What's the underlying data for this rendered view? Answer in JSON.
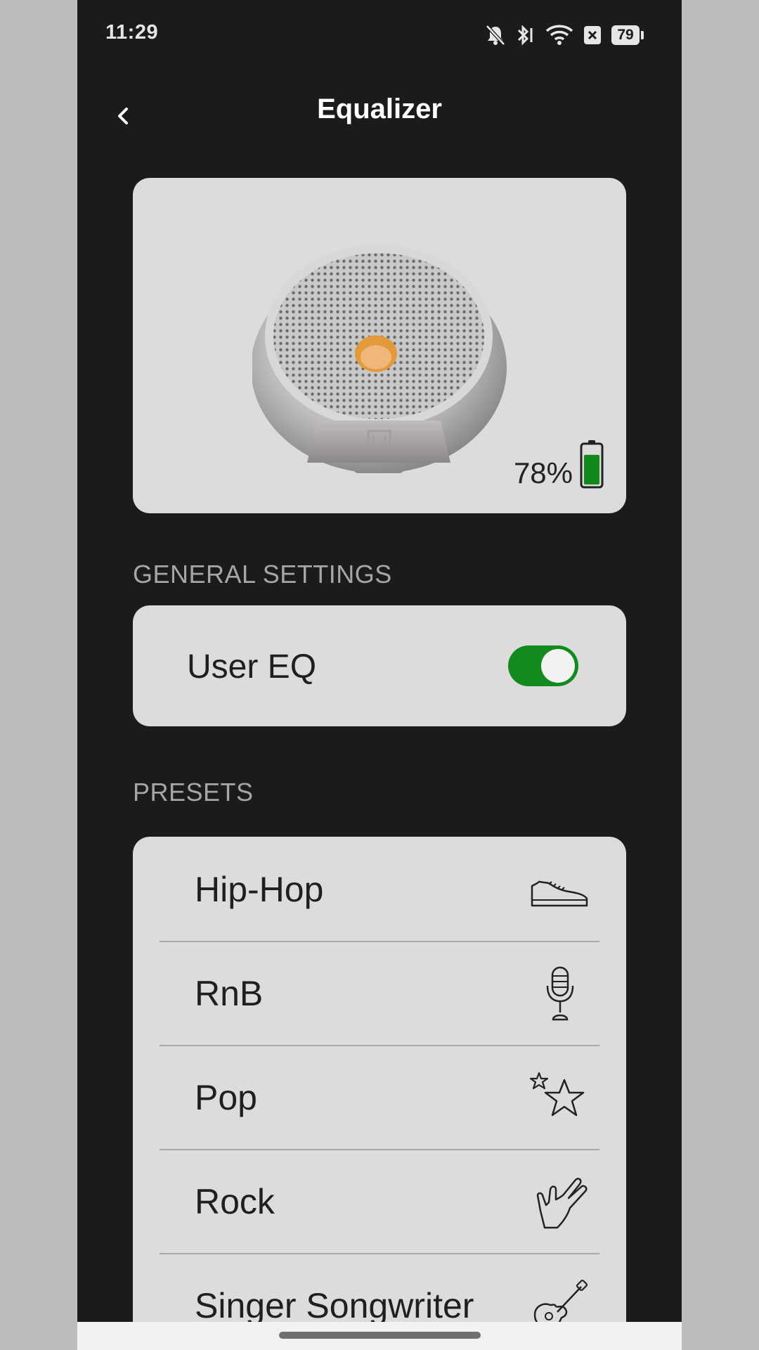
{
  "status_bar": {
    "time": "11:29",
    "battery_level": "79",
    "icons": [
      "bell-off-icon",
      "bluetooth-icon",
      "wifi-icon",
      "x-box-icon",
      "battery-icon"
    ]
  },
  "header": {
    "title": "Equalizer",
    "back_icon": "chevron-left-icon"
  },
  "device": {
    "battery_percent": "78%",
    "battery_fraction": 0.78,
    "battery_color": "#128a1b",
    "image": "speaker-image"
  },
  "general_settings": {
    "section_label": "GENERAL SETTINGS",
    "user_eq": {
      "label": "User EQ",
      "enabled": true
    }
  },
  "presets": {
    "section_label": "PRESETS",
    "items": [
      {
        "label": "Hip-Hop",
        "icon": "sneaker-icon"
      },
      {
        "label": "RnB",
        "icon": "microphone-icon"
      },
      {
        "label": "Pop",
        "icon": "stars-icon"
      },
      {
        "label": "Rock",
        "icon": "rock-hand-icon"
      },
      {
        "label": "Singer Songwriter",
        "icon": "guitar-icon"
      }
    ]
  },
  "colors": {
    "background": "#1b1b1b",
    "card": "#dcdcdc",
    "accent_green": "#138a1d",
    "section_label": "#a6a6a6"
  }
}
